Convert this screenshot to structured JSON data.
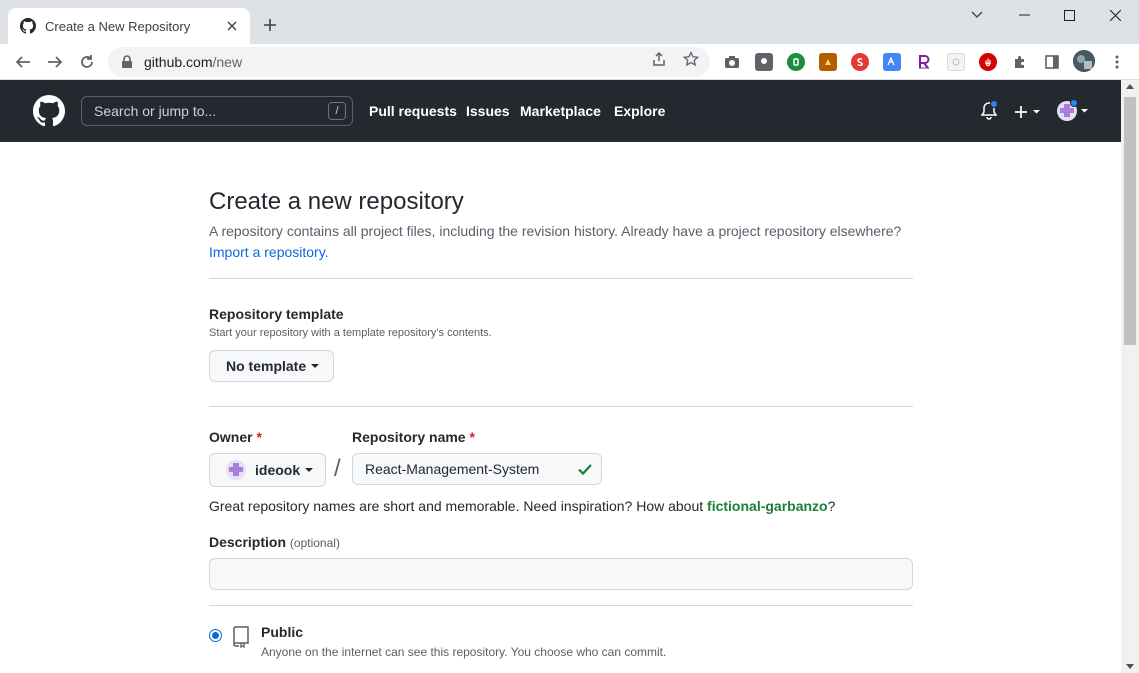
{
  "browser": {
    "tab_title": "Create a New Repository",
    "url_domain": "github.com",
    "url_path": "/new"
  },
  "header": {
    "search_placeholder": "Search or jump to...",
    "search_key": "/",
    "nav": [
      "Pull requests",
      "Issues",
      "Marketplace",
      "Explore"
    ]
  },
  "page": {
    "title": "Create a new repository",
    "subtitle": "A repository contains all project files, including the revision history. Already have a project repository elsewhere?",
    "import_link": "Import a repository.",
    "template_label": "Repository template",
    "template_note": "Start your repository with a template repository's contents.",
    "template_value": "No template",
    "owner_label": "Owner",
    "required_mark": "*",
    "owner_value": "ideook",
    "separator": "/",
    "repo_label": "Repository name",
    "repo_value": "React-Management-System",
    "inspiration_text": "Great repository names are short and memorable. Need inspiration? How about ",
    "inspiration_name": "fictional-garbanzo",
    "inspiration_end": "?",
    "description_label": "Description",
    "description_optional": "(optional)",
    "description_value": "",
    "visibility": {
      "public_label": "Public",
      "public_note": "Anyone on the internet can see this repository. You choose who can commit.",
      "public_selected": true
    }
  },
  "colors": {
    "header_bg": "#24292f",
    "link": "#0969da",
    "success": "#1a7f37",
    "required": "#cf222e"
  }
}
